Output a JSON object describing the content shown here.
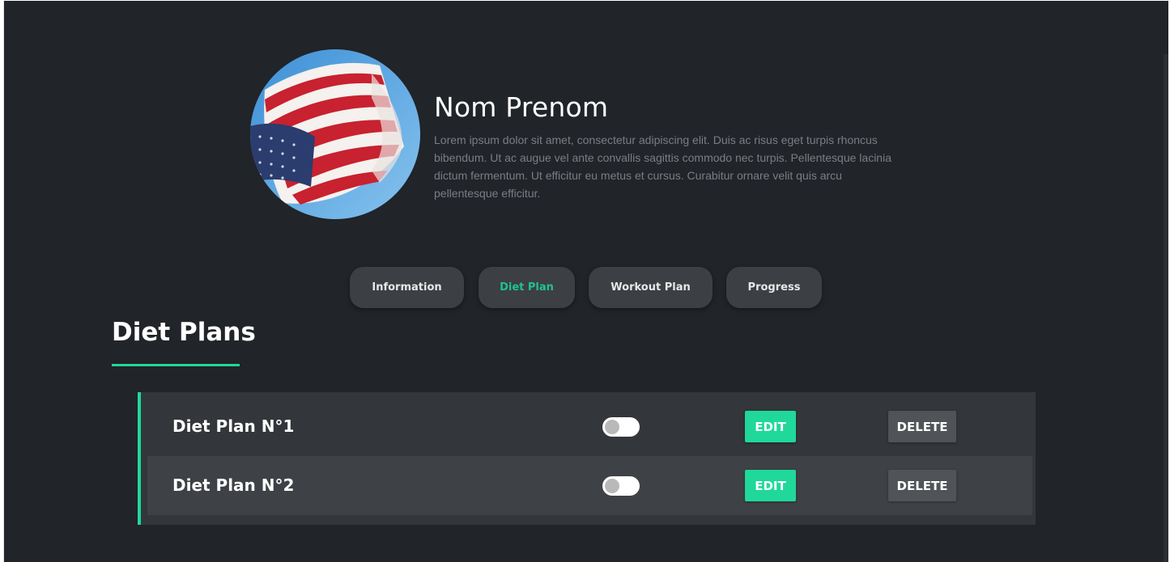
{
  "profile": {
    "name": "Nom Prenom",
    "bio": "Lorem ipsum dolor sit amet, consectetur adipiscing elit. Duis ac risus eget turpis rhoncus bibendum. Ut ac augue vel ante convallis sagittis commodo nec turpis. Pellentesque lacinia dictum fermentum. Ut efficitur eu metus et cursus. Curabitur ornare velit quis arcu pellentesque efficitur.",
    "avatar_icon": "us-flag-photo"
  },
  "tabs": [
    {
      "label": "Information",
      "active": false
    },
    {
      "label": "Diet Plan",
      "active": true
    },
    {
      "label": "Workout Plan",
      "active": false
    },
    {
      "label": "Progress",
      "active": false
    }
  ],
  "section": {
    "title": "Diet Plans"
  },
  "plans": [
    {
      "name": "Diet Plan N°1",
      "enabled": false,
      "edit_label": "EDIT",
      "delete_label": "DELETE"
    },
    {
      "name": "Diet Plan N°2",
      "enabled": false,
      "edit_label": "EDIT",
      "delete_label": "DELETE"
    }
  ],
  "colors": {
    "background": "#212428",
    "accent": "#1fd89a",
    "tab_bg": "#3c3f44",
    "panel_bg": "#33363a",
    "delete_bg": "#505357"
  }
}
